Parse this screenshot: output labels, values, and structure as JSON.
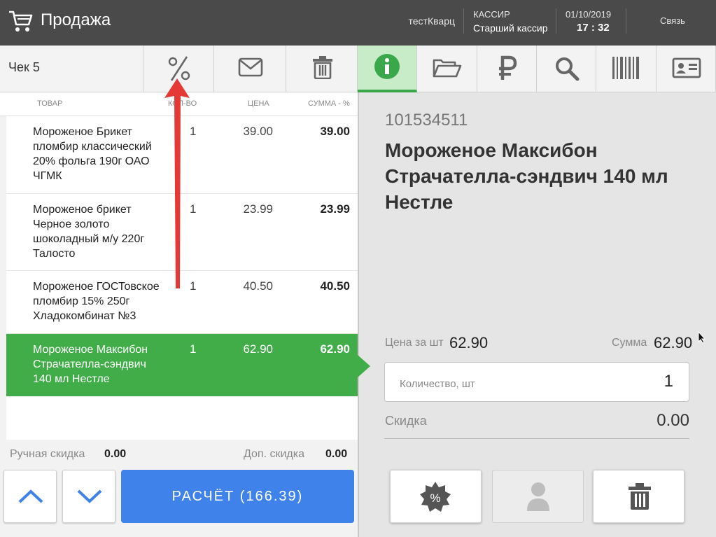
{
  "header": {
    "title": "Продажа",
    "user": "тестКварц",
    "role_label": "КАССИР",
    "role_name": "Старший кассир",
    "date": "01/10/2019",
    "time": "17 : 32",
    "connection": "Связь"
  },
  "receipt": {
    "label": "Чек 5"
  },
  "table": {
    "columns": [
      "ТОВАР",
      "КОЛ-ВО",
      "ЦЕНА",
      "СУММА - %"
    ],
    "rows": [
      {
        "name": "Мороженое Брикет пломбир классический 20% фольга 190г ОАО ЧГМК",
        "qty": "1",
        "price": "39.00",
        "sum": "39.00"
      },
      {
        "name": "Мороженое брикет Черное золото шоколадный м/у 220г Талосто",
        "qty": "1",
        "price": "23.99",
        "sum": "23.99"
      },
      {
        "name": "Мороженое ГОСТовское пломбир 15% 250г Хладокомбинат №3",
        "qty": "1",
        "price": "40.50",
        "sum": "40.50"
      },
      {
        "name": "Мороженое Максибон Страчателла-сэндвич 140 мл Нестле",
        "qty": "1",
        "price": "62.90",
        "sum": "62.90"
      }
    ]
  },
  "discounts": {
    "manual_label": "Ручная скидка",
    "manual_value": "0.00",
    "extra_label": "Доп. скидка",
    "extra_value": "0.00"
  },
  "pay_button": "РАСЧЁТ (166.39)",
  "product": {
    "code": "101534511",
    "name": "Мороженое Максибон Страчателла-сэндвич 140 мл Нестле",
    "price_label": "Цена за шт",
    "price_value": "62.90",
    "sum_label": "Сумма",
    "sum_value": "62.90",
    "qty_label": "Количество, шт",
    "qty_value": "1",
    "discount_label": "Скидка",
    "discount_value": "0.00"
  },
  "icons": {
    "left_toolbar": [
      "percent-icon",
      "envelope-icon",
      "trash-icon"
    ],
    "right_toolbar": [
      "info-icon",
      "folder-open-icon",
      "ruble-icon",
      "search-icon",
      "barcode-icon",
      "id-card-icon"
    ],
    "product_actions": [
      "discount-badge-icon",
      "person-icon",
      "trash-icon"
    ]
  },
  "colors": {
    "accent_green": "#41ad49",
    "pay_blue": "#3f82ea",
    "header_bg": "#4a4a4a",
    "annotation_red": "#e53935"
  }
}
